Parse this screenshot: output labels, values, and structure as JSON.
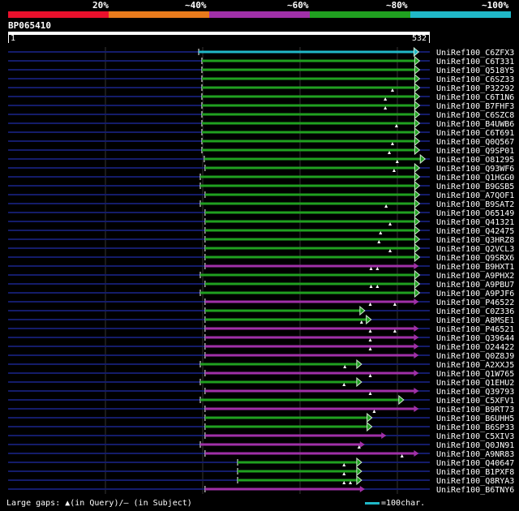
{
  "legend": {
    "labels": [
      "20%",
      "~40%",
      "~60%",
      "~80%",
      "~100%"
    ],
    "colors": [
      "#e8102c",
      "#e87a1c",
      "#a030a8",
      "#20a020",
      "#20b8c8"
    ]
  },
  "query": {
    "name": "BP065410",
    "start": "1",
    "end": "532",
    "length": 532
  },
  "hits": [
    {
      "name": "UniRef100_C6ZFX3",
      "color": "#20b8c8",
      "start": 241,
      "end": 512,
      "arrow": true,
      "marks": []
    },
    {
      "name": "UniRef100_C6T331",
      "color": "#20a020",
      "start": 245,
      "end": 513,
      "arrow": true,
      "marks": []
    },
    {
      "name": "UniRef100_Q518Y5",
      "color": "#20a020",
      "start": 245,
      "end": 513,
      "arrow": true,
      "marks": []
    },
    {
      "name": "UniRef100_C6SZ33",
      "color": "#20a020",
      "start": 245,
      "end": 513,
      "arrow": true,
      "marks": []
    },
    {
      "name": "UniRef100_P32292",
      "color": "#20a020",
      "start": 245,
      "end": 513,
      "arrow": true,
      "marks": [
        485
      ]
    },
    {
      "name": "UniRef100_C6T1N6",
      "color": "#20a020",
      "start": 245,
      "end": 513,
      "arrow": true,
      "marks": [
        476
      ]
    },
    {
      "name": "UniRef100_B7FHF3",
      "color": "#20a020",
      "start": 245,
      "end": 513,
      "arrow": true,
      "marks": [
        476
      ]
    },
    {
      "name": "UniRef100_C6SZC8",
      "color": "#20a020",
      "start": 245,
      "end": 513,
      "arrow": true,
      "marks": []
    },
    {
      "name": "UniRef100_B4UWB6",
      "color": "#20a020",
      "start": 245,
      "end": 513,
      "arrow": true,
      "marks": [
        490
      ]
    },
    {
      "name": "UniRef100_C6T691",
      "color": "#20a020",
      "start": 245,
      "end": 513,
      "arrow": true,
      "marks": []
    },
    {
      "name": "UniRef100_Q0Q567",
      "color": "#20a020",
      "start": 245,
      "end": 513,
      "arrow": true,
      "marks": [
        485
      ]
    },
    {
      "name": "UniRef100_Q9SP01",
      "color": "#20a020",
      "start": 245,
      "end": 513,
      "arrow": true,
      "marks": [
        481
      ]
    },
    {
      "name": "UniRef100_O81295",
      "color": "#20a020",
      "start": 248,
      "end": 520,
      "arrow": true,
      "marks": [
        491
      ]
    },
    {
      "name": "UniRef100_Q93WF6",
      "color": "#20a020",
      "start": 249,
      "end": 513,
      "arrow": true,
      "marks": [
        487
      ]
    },
    {
      "name": "UniRef100_Q1HGG0",
      "color": "#20a020",
      "start": 243,
      "end": 513,
      "arrow": true,
      "marks": []
    },
    {
      "name": "UniRef100_B9GSB5",
      "color": "#20a020",
      "start": 243,
      "end": 513,
      "arrow": true,
      "marks": []
    },
    {
      "name": "UniRef100_A7QOF1",
      "color": "#20a020",
      "start": 249,
      "end": 513,
      "arrow": true,
      "marks": []
    },
    {
      "name": "UniRef100_B9SAT2",
      "color": "#20a020",
      "start": 243,
      "end": 513,
      "arrow": true,
      "marks": [
        477
      ]
    },
    {
      "name": "UniRef100_O65149",
      "color": "#20a020",
      "start": 249,
      "end": 513,
      "arrow": true,
      "marks": []
    },
    {
      "name": "UniRef100_Q41321",
      "color": "#20a020",
      "start": 249,
      "end": 513,
      "arrow": true,
      "marks": [
        482
      ]
    },
    {
      "name": "UniRef100_Q42475",
      "color": "#20a020",
      "start": 249,
      "end": 513,
      "arrow": true,
      "marks": [
        470
      ]
    },
    {
      "name": "UniRef100_Q3HRZ8",
      "color": "#20a020",
      "start": 249,
      "end": 513,
      "arrow": true,
      "marks": [
        468
      ]
    },
    {
      "name": "UniRef100_Q2VCL3",
      "color": "#20a020",
      "start": 249,
      "end": 513,
      "arrow": true,
      "marks": [
        482
      ]
    },
    {
      "name": "UniRef100_Q9SRX6",
      "color": "#20a020",
      "start": 249,
      "end": 513,
      "arrow": true,
      "marks": []
    },
    {
      "name": "UniRef100_B9HXT1",
      "color": "#a030a8",
      "start": 249,
      "end": 513,
      "arrow": false,
      "marks": [
        458,
        466
      ]
    },
    {
      "name": "UniRef100_A9PHX2",
      "color": "#20a020",
      "start": 243,
      "end": 513,
      "arrow": true,
      "marks": []
    },
    {
      "name": "UniRef100_A9PBU7",
      "color": "#20a020",
      "start": 249,
      "end": 513,
      "arrow": true,
      "marks": [
        458,
        466
      ]
    },
    {
      "name": "UniRef100_A9PJF6",
      "color": "#20a020",
      "start": 243,
      "end": 513,
      "arrow": true,
      "marks": []
    },
    {
      "name": "UniRef100_P46522",
      "color": "#a030a8",
      "start": 249,
      "end": 513,
      "arrow": false,
      "marks": [
        457,
        488
      ]
    },
    {
      "name": "UniRef100_C0Z336",
      "color": "#20a020",
      "start": 249,
      "end": 444,
      "arrow": true,
      "marks": []
    },
    {
      "name": "UniRef100_A8MSE1",
      "color": "#20a020",
      "start": 249,
      "end": 452,
      "arrow": true,
      "marks": [
        446
      ]
    },
    {
      "name": "UniRef100_P46521",
      "color": "#a030a8",
      "start": 249,
      "end": 513,
      "arrow": false,
      "marks": [
        457,
        488
      ]
    },
    {
      "name": "UniRef100_Q39644",
      "color": "#a030a8",
      "start": 249,
      "end": 513,
      "arrow": false,
      "marks": [
        457
      ]
    },
    {
      "name": "UniRef100_O24422",
      "color": "#a030a8",
      "start": 249,
      "end": 513,
      "arrow": false,
      "marks": [
        457
      ]
    },
    {
      "name": "UniRef100_Q0Z8J9",
      "color": "#a030a8",
      "start": 249,
      "end": 513,
      "arrow": false,
      "marks": []
    },
    {
      "name": "UniRef100_A2XXJ5",
      "color": "#20a020",
      "start": 243,
      "end": 440,
      "arrow": true,
      "marks": [
        425
      ]
    },
    {
      "name": "UniRef100_Q1W765",
      "color": "#a030a8",
      "start": 249,
      "end": 513,
      "arrow": false,
      "marks": [
        457
      ]
    },
    {
      "name": "UniRef100_Q1EHU2",
      "color": "#20a020",
      "start": 243,
      "end": 440,
      "arrow": true,
      "marks": [
        424
      ]
    },
    {
      "name": "UniRef100_Q39793",
      "color": "#a030a8",
      "start": 249,
      "end": 513,
      "arrow": false,
      "marks": [
        457
      ]
    },
    {
      "name": "UniRef100_C5XFV1",
      "color": "#20a020",
      "start": 243,
      "end": 493,
      "arrow": true,
      "marks": []
    },
    {
      "name": "UniRef100_B9RT73",
      "color": "#a030a8",
      "start": 249,
      "end": 513,
      "arrow": false,
      "marks": [
        462
      ]
    },
    {
      "name": "UniRef100_B6UHH5",
      "color": "#20a020",
      "start": 249,
      "end": 453,
      "arrow": true,
      "marks": []
    },
    {
      "name": "UniRef100_B6SP33",
      "color": "#20a020",
      "start": 249,
      "end": 453,
      "arrow": true,
      "marks": []
    },
    {
      "name": "UniRef100_C5XIV3",
      "color": "#a030a8",
      "start": 249,
      "end": 472,
      "arrow": false,
      "marks": []
    },
    {
      "name": "UniRef100_Q0JN91",
      "color": "#a030a8",
      "start": 243,
      "end": 445,
      "arrow": false,
      "marks": [
        443
      ]
    },
    {
      "name": "UniRef100_A9NR83",
      "color": "#a030a8",
      "start": 249,
      "end": 513,
      "arrow": false,
      "marks": [
        497
      ]
    },
    {
      "name": "UniRef100_Q40647",
      "color": "#20a020",
      "start": 290,
      "end": 440,
      "arrow": true,
      "marks": [
        424
      ]
    },
    {
      "name": "UniRef100_B1PXF8",
      "color": "#20a020",
      "start": 290,
      "end": 440,
      "arrow": true,
      "marks": [
        424
      ]
    },
    {
      "name": "UniRef100_Q8RYA3",
      "color": "#20a020",
      "start": 290,
      "end": 440,
      "arrow": true,
      "marks": [
        424,
        432
      ]
    },
    {
      "name": "UniRef100_B6TNY6",
      "color": "#a030a8",
      "start": 249,
      "end": 445,
      "arrow": false,
      "marks": []
    }
  ],
  "footer": {
    "gaps_text": "Large gaps: ▲(in Query)/— (in Subject)",
    "scale_text": "=100char."
  }
}
